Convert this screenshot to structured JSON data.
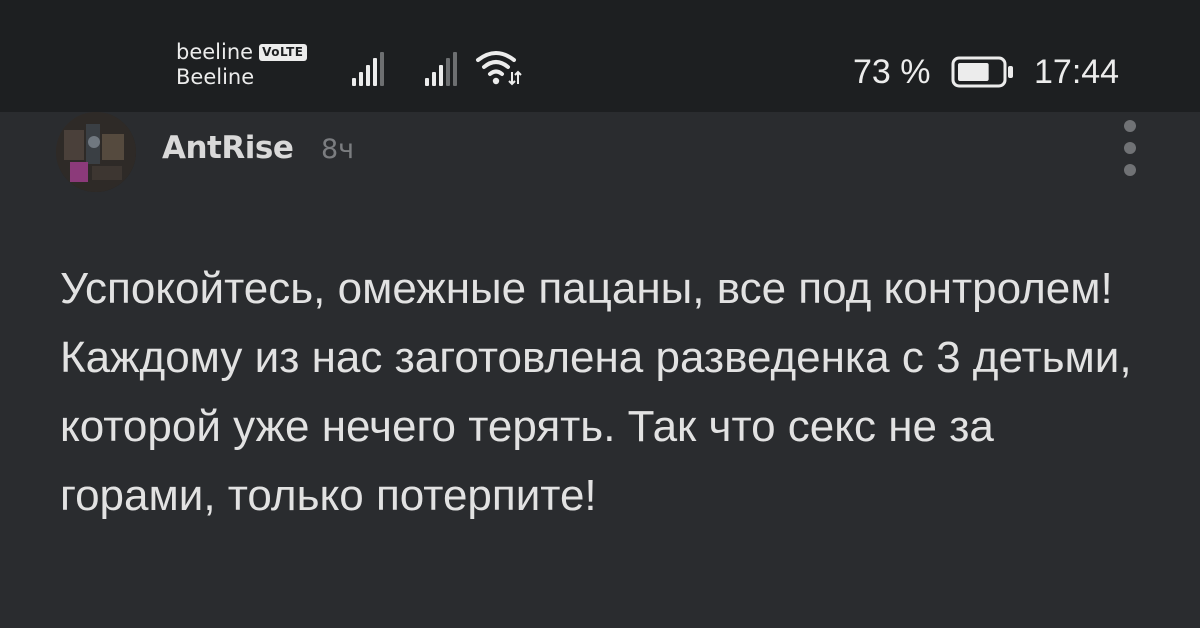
{
  "status_bar": {
    "carrier_top": "beeline",
    "volte_badge": "VoLTE",
    "carrier_bottom": "Beeline",
    "battery_percent": "73 %",
    "battery_level": 0.73,
    "time": "17:44",
    "icons": [
      "signal-icon",
      "signal-icon",
      "wifi-icon",
      "battery-icon"
    ]
  },
  "comment": {
    "author": "AntRise",
    "time_ago": "8ч",
    "text": "Успокойтесь, омежные пацаны, все под контролем! Каждому из нас заготовлена разведенка с 3 детьми, которой уже нечего терять. Так что секс не за горами, только потерпите!"
  }
}
